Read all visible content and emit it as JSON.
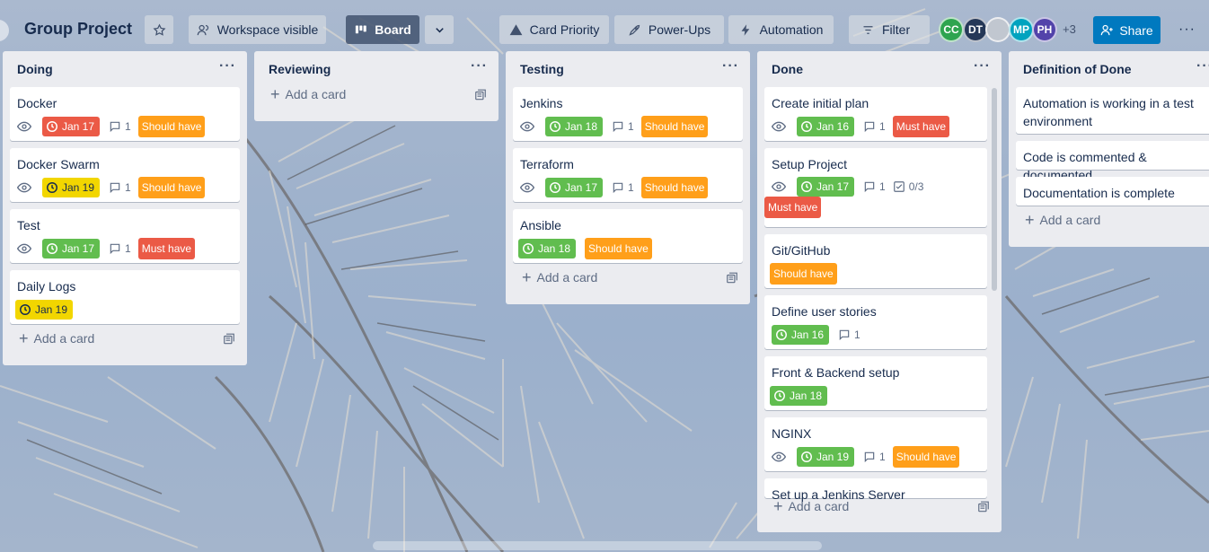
{
  "header": {
    "title": "Group Project",
    "star_icon": "star-icon",
    "workspace_visible": "Workspace visible",
    "board_view": "Board",
    "card_priority": "Card Priority",
    "power_ups": "Power-Ups",
    "automation": "Automation",
    "filter": "Filter",
    "avatars": [
      {
        "initials": "CC",
        "color": "#2ea44f"
      },
      {
        "initials": "DT",
        "color": "#253858"
      },
      {
        "initials": "",
        "color": "#c1c7d0"
      },
      {
        "initials": "MP",
        "color": "#00a3bf"
      },
      {
        "initials": "PH",
        "color": "#5243aa"
      }
    ],
    "more_members": "+3",
    "share": "Share"
  },
  "colors": {
    "due_red": "#eb5a46",
    "due_yellow": "#f2d600",
    "due_green": "#61bd4f",
    "label_orange": "#ff9f1a",
    "label_red": "#eb5a46",
    "share_blue": "#0079bf"
  },
  "lists": [
    {
      "title": "Doing",
      "cards": [
        {
          "title": "Docker",
          "watch": true,
          "due": "Jan 17",
          "due_status": "red",
          "comments": "1",
          "label": "Should have"
        },
        {
          "title": "Docker Swarm",
          "watch": true,
          "due": "Jan 19",
          "due_status": "yellow",
          "comments": "1",
          "label": "Should have"
        },
        {
          "title": "Test",
          "watch": true,
          "due": "Jan 17",
          "due_status": "green",
          "comments": "1",
          "label": "Must have"
        },
        {
          "title": "Daily Logs",
          "due": "Jan 19",
          "due_status": "yellow"
        }
      ],
      "add_card": "Add a card"
    },
    {
      "title": "Reviewing",
      "cards": [],
      "add_card": "Add a card"
    },
    {
      "title": "Testing",
      "cards": [
        {
          "title": "Jenkins",
          "watch": true,
          "due": "Jan 18",
          "due_status": "green",
          "comments": "1",
          "label": "Should have"
        },
        {
          "title": "Terraform",
          "watch": true,
          "due": "Jan 17",
          "due_status": "green",
          "comments": "1",
          "label": "Should have"
        },
        {
          "title": "Ansible",
          "due": "Jan 18",
          "due_status": "green",
          "label": "Should have"
        }
      ],
      "add_card": "Add a card"
    },
    {
      "title": "Done",
      "cards": [
        {
          "title": "Create initial plan",
          "watch": true,
          "due": "Jan 16",
          "due_status": "green",
          "comments": "1",
          "label": "Must have"
        },
        {
          "title": "Setup Project",
          "watch": true,
          "due": "Jan 17",
          "due_status": "green",
          "comments": "1",
          "checklist": "0/3",
          "label": "Must have"
        },
        {
          "title": "Git/GitHub",
          "label": "Should have"
        },
        {
          "title": "Define user stories",
          "due": "Jan 16",
          "due_status": "green",
          "comments": "1"
        },
        {
          "title": "Front & Backend setup",
          "due": "Jan 18",
          "due_status": "green"
        },
        {
          "title": "NGINX",
          "watch": true,
          "due": "Jan 19",
          "due_status": "green",
          "comments": "1",
          "label": "Should have"
        },
        {
          "title": "Set up a Jenkins Server"
        }
      ],
      "add_card": "Add a card"
    },
    {
      "title": "Definition of Done",
      "cards": [
        {
          "title": "Automation is working in a test environment"
        },
        {
          "title": "Code is commented & documented"
        },
        {
          "title": "Documentation is complete"
        }
      ],
      "add_card": "Add a card"
    }
  ]
}
